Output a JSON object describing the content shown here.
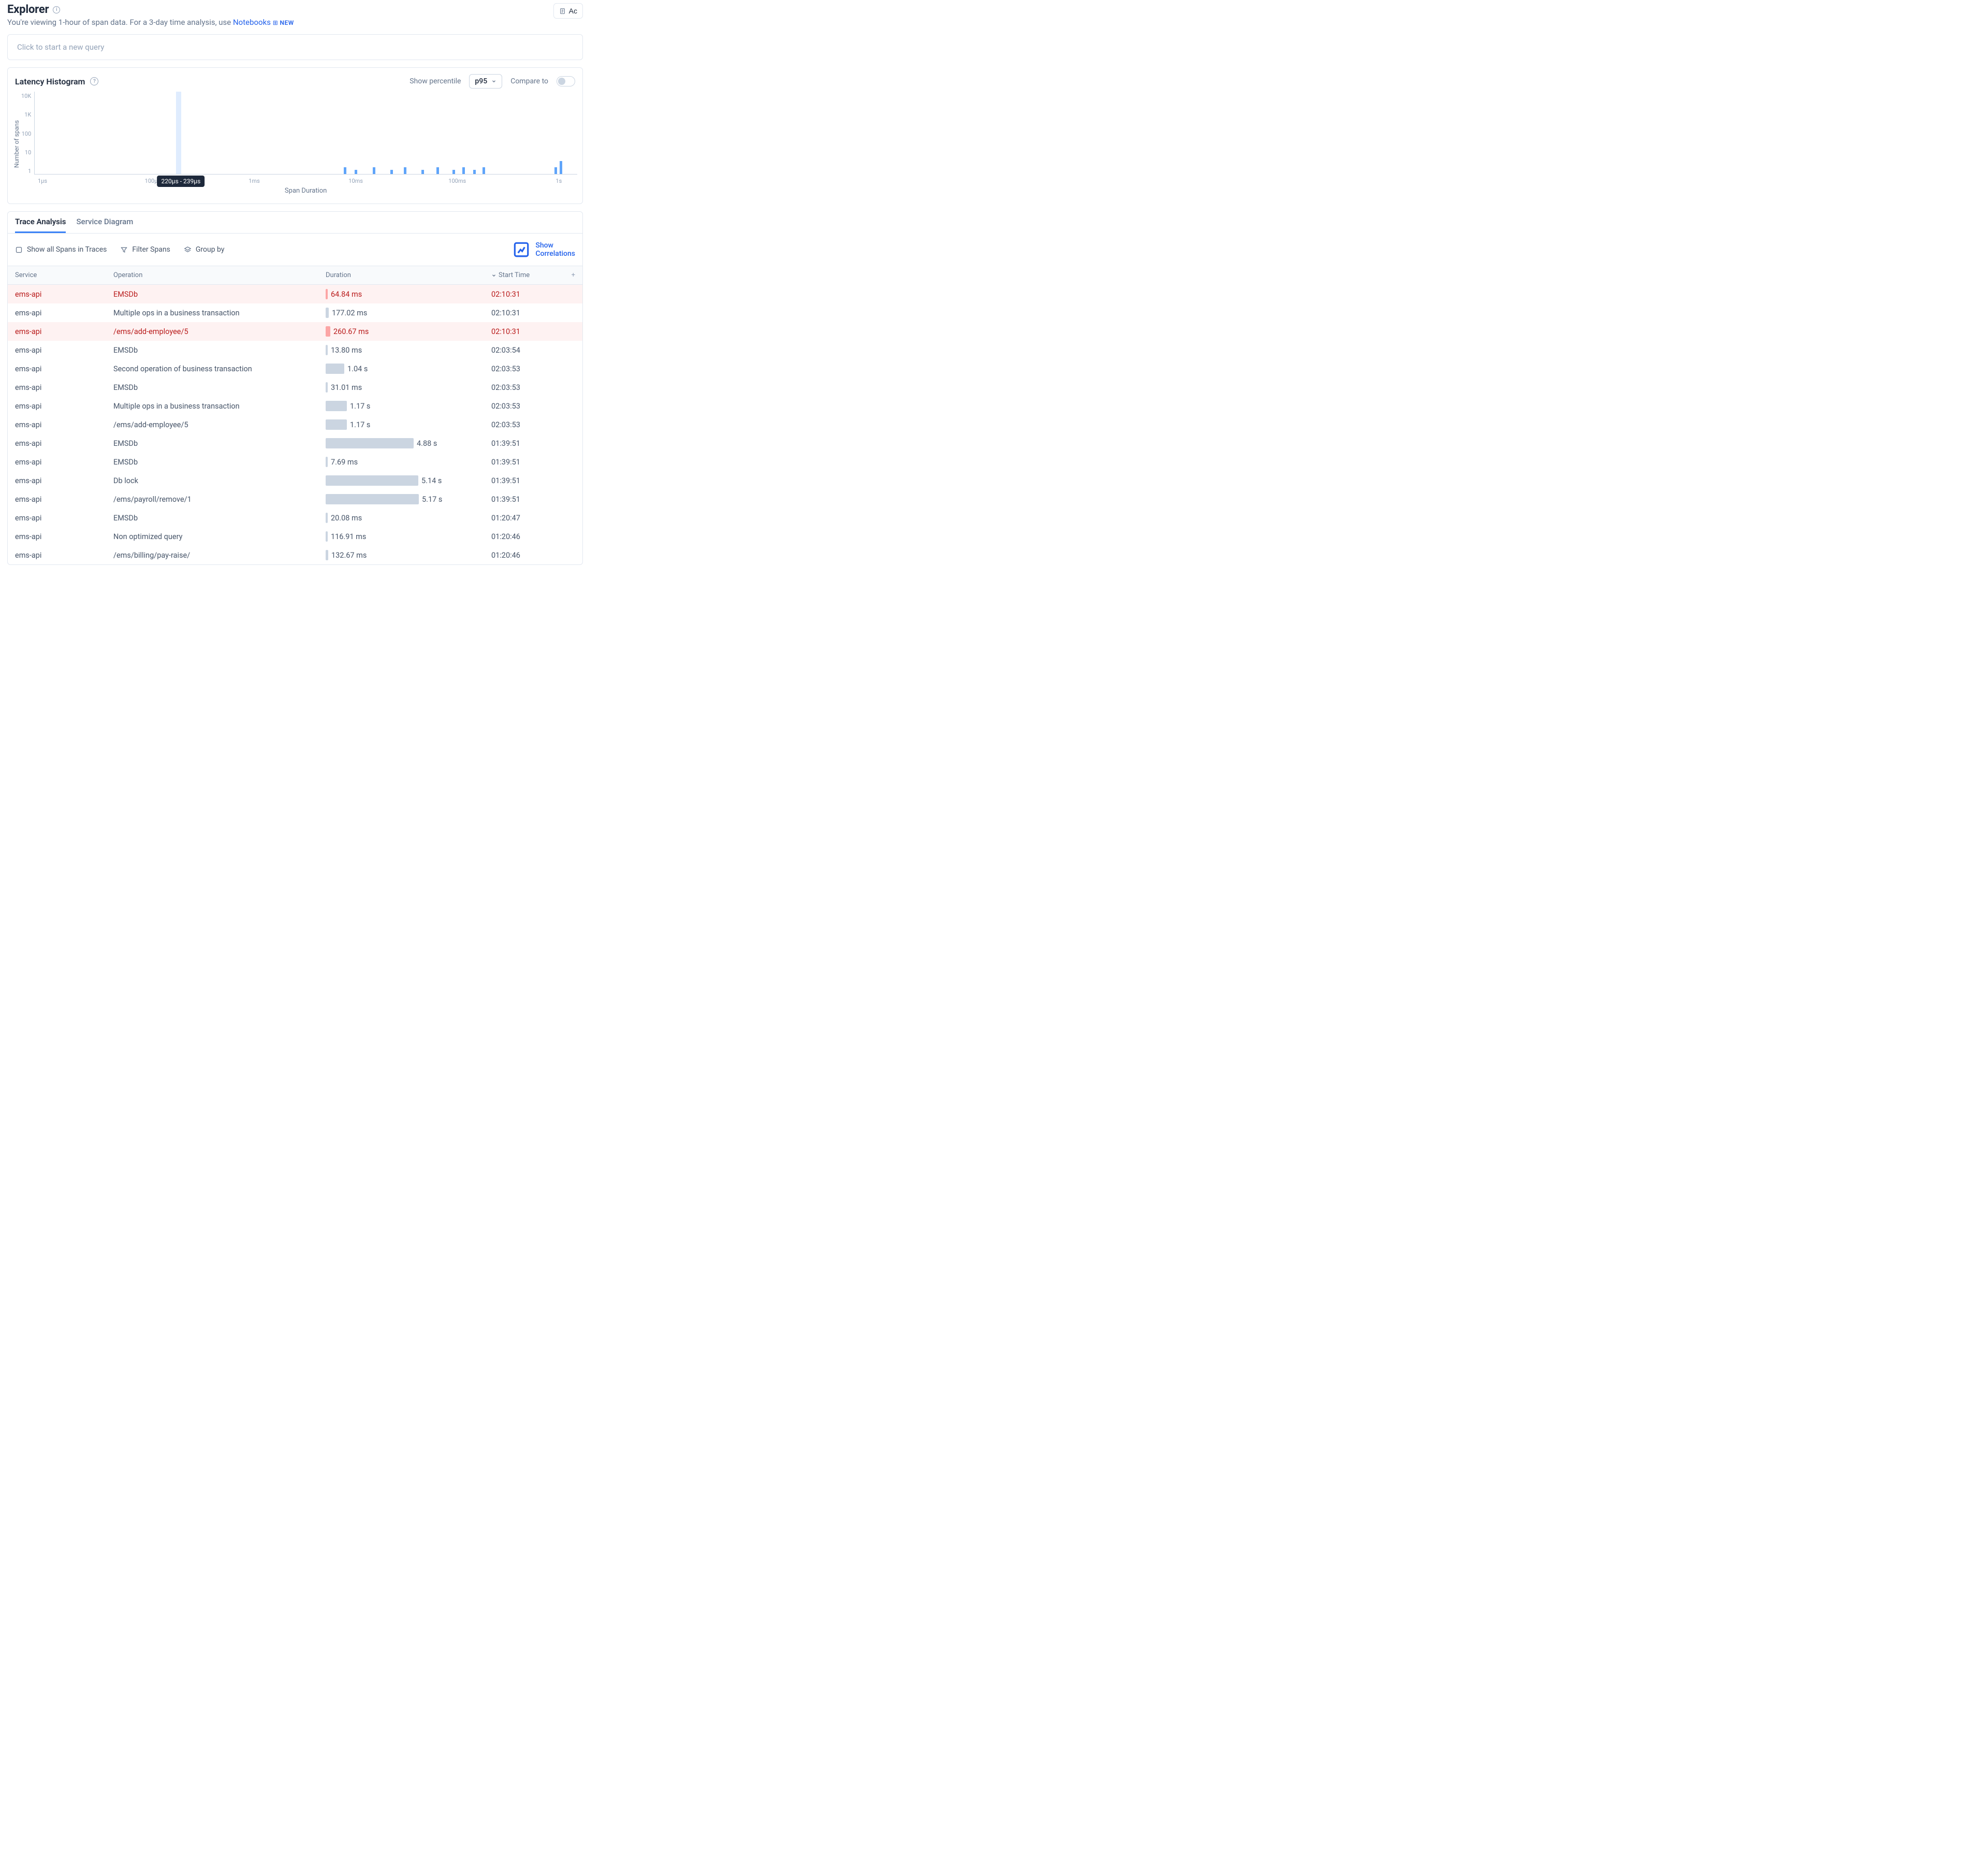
{
  "header": {
    "title": "Explorer",
    "subtitle_pre": "You're viewing 1-hour of span data. For a 3-day time analysis, use ",
    "notebooks": "Notebooks",
    "new": "NEW",
    "actions_button": "Ac"
  },
  "query": {
    "placeholder": "Click to start a new query"
  },
  "histogram": {
    "title": "Latency Histogram",
    "show_percentile": "Show percentile",
    "percentile": "p95",
    "compare_to": "Compare to",
    "ylabel": "Number of spans",
    "xlabel": "Span Duration",
    "tooltip": "220µs - 239µs"
  },
  "chart_data": {
    "type": "bar",
    "y_scale": "log",
    "y_ticks": [
      "10K",
      "1K",
      "100",
      "10",
      "1"
    ],
    "ylabel": "Number of spans",
    "xlabel": "Span Duration",
    "x_scale": "log",
    "x_ticks": [
      {
        "label": "1µs",
        "pos_pct": 1.5
      },
      {
        "label": "100µs",
        "pos_pct": 21.8
      },
      {
        "label": "1ms",
        "pos_pct": 40.5
      },
      {
        "label": "10ms",
        "pos_pct": 59.2
      },
      {
        "label": "100ms",
        "pos_pct": 77.9
      },
      {
        "label": "1s",
        "pos_pct": 96.6
      }
    ],
    "highlight_band": {
      "label": "220µs - 239µs",
      "pos_pct": 26.0
    },
    "bars": [
      {
        "pos_pct": 57.0,
        "h_pct": 8
      },
      {
        "pos_pct": 59.0,
        "h_pct": 5
      },
      {
        "pos_pct": 62.3,
        "h_pct": 8
      },
      {
        "pos_pct": 65.5,
        "h_pct": 5
      },
      {
        "pos_pct": 68.0,
        "h_pct": 8
      },
      {
        "pos_pct": 71.3,
        "h_pct": 5
      },
      {
        "pos_pct": 74.0,
        "h_pct": 8
      },
      {
        "pos_pct": 77.0,
        "h_pct": 5
      },
      {
        "pos_pct": 78.8,
        "h_pct": 8
      },
      {
        "pos_pct": 80.8,
        "h_pct": 5
      },
      {
        "pos_pct": 82.5,
        "h_pct": 8
      },
      {
        "pos_pct": 95.8,
        "h_pct": 8
      },
      {
        "pos_pct": 96.8,
        "h_pct": 16
      }
    ]
  },
  "tabs": {
    "trace": "Trace Analysis",
    "service": "Service Diagram"
  },
  "toolbar": {
    "show_all": "Show all Spans in Traces",
    "filter": "Filter Spans",
    "group": "Group by",
    "correlations": "Show Correlations"
  },
  "columns": {
    "service": "Service",
    "operation": "Operation",
    "duration": "Duration",
    "start": "Start Time"
  },
  "max_duration_ms": 5170,
  "rows": [
    {
      "svc": "ems-api",
      "op": "EMSDb",
      "dur_text": "64.84 ms",
      "dur_ms": 64.84,
      "start": "02:10:31",
      "err": true
    },
    {
      "svc": "ems-api",
      "op": "Multiple ops in a business transaction",
      "dur_text": "177.02 ms",
      "dur_ms": 177.02,
      "start": "02:10:31",
      "err": false
    },
    {
      "svc": "ems-api",
      "op": "/ems/add-employee/5",
      "dur_text": "260.67 ms",
      "dur_ms": 260.67,
      "start": "02:10:31",
      "err": true
    },
    {
      "svc": "ems-api",
      "op": "EMSDb",
      "dur_text": "13.80 ms",
      "dur_ms": 13.8,
      "start": "02:03:54",
      "err": false
    },
    {
      "svc": "ems-api",
      "op": "Second operation of business transaction",
      "dur_text": "1.04 s",
      "dur_ms": 1040,
      "start": "02:03:53",
      "err": false
    },
    {
      "svc": "ems-api",
      "op": "EMSDb",
      "dur_text": "31.01 ms",
      "dur_ms": 31.01,
      "start": "02:03:53",
      "err": false
    },
    {
      "svc": "ems-api",
      "op": "Multiple ops in a business transaction",
      "dur_text": "1.17 s",
      "dur_ms": 1170,
      "start": "02:03:53",
      "err": false
    },
    {
      "svc": "ems-api",
      "op": "/ems/add-employee/5",
      "dur_text": "1.17 s",
      "dur_ms": 1170,
      "start": "02:03:53",
      "err": false
    },
    {
      "svc": "ems-api",
      "op": "EMSDb",
      "dur_text": "4.88 s",
      "dur_ms": 4880,
      "start": "01:39:51",
      "err": false
    },
    {
      "svc": "ems-api",
      "op": "EMSDb",
      "dur_text": "7.69 ms",
      "dur_ms": 7.69,
      "start": "01:39:51",
      "err": false
    },
    {
      "svc": "ems-api",
      "op": "Db lock",
      "dur_text": "5.14 s",
      "dur_ms": 5140,
      "start": "01:39:51",
      "err": false
    },
    {
      "svc": "ems-api",
      "op": "/ems/payroll/remove/1",
      "dur_text": "5.17 s",
      "dur_ms": 5170,
      "start": "01:39:51",
      "err": false
    },
    {
      "svc": "ems-api",
      "op": "EMSDb",
      "dur_text": "20.08 ms",
      "dur_ms": 20.08,
      "start": "01:20:47",
      "err": false
    },
    {
      "svc": "ems-api",
      "op": "Non optimized query",
      "dur_text": "116.91 ms",
      "dur_ms": 116.91,
      "start": "01:20:46",
      "err": false
    },
    {
      "svc": "ems-api",
      "op": "/ems/billing/pay-raise/",
      "dur_text": "132.67 ms",
      "dur_ms": 132.67,
      "start": "01:20:46",
      "err": false
    }
  ]
}
